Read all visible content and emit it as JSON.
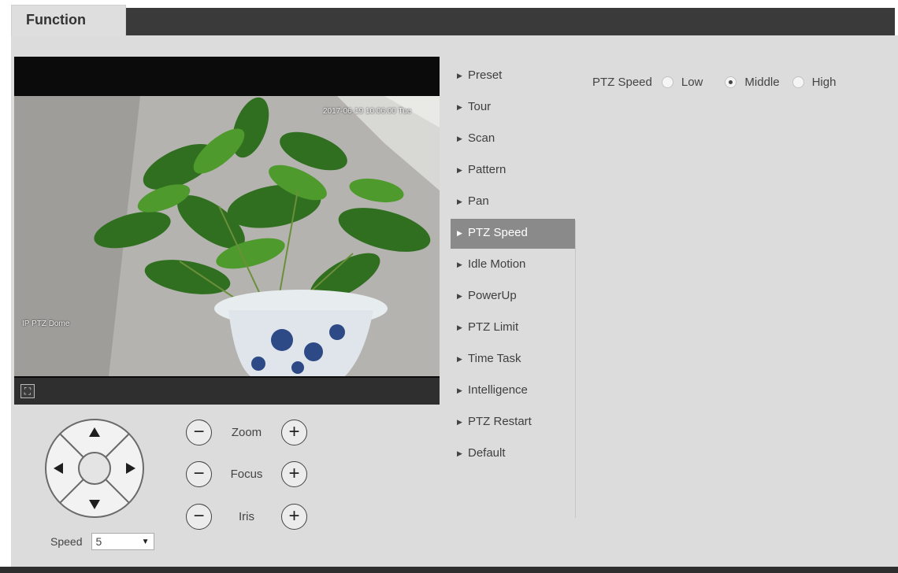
{
  "header": {
    "tab_label": "Function"
  },
  "video": {
    "timestamp": "2017-06-19 10:06:00 Tue",
    "channel_name": "IP PTZ Dome",
    "fullscreen_icon": "fullscreen-icon"
  },
  "ptz_control": {
    "speed_label": "Speed",
    "speed_value": "5",
    "zoom_label": "Zoom",
    "focus_label": "Focus",
    "iris_label": "Iris"
  },
  "menu": {
    "items": [
      {
        "label": "Preset"
      },
      {
        "label": "Tour"
      },
      {
        "label": "Scan"
      },
      {
        "label": "Pattern"
      },
      {
        "label": "Pan"
      },
      {
        "label": "PTZ Speed",
        "active": true
      },
      {
        "label": "Idle Motion"
      },
      {
        "label": "PowerUp"
      },
      {
        "label": "PTZ Limit"
      },
      {
        "label": "Time Task"
      },
      {
        "label": "Intelligence"
      },
      {
        "label": "PTZ Restart"
      },
      {
        "label": "Default"
      }
    ]
  },
  "settings": {
    "ptz_speed_label": "PTZ Speed",
    "options": [
      {
        "label": "Low",
        "checked": false
      },
      {
        "label": "Middle",
        "checked": true
      },
      {
        "label": "High",
        "checked": false
      }
    ]
  },
  "colors": {
    "panel_bg": "#dcdcdc",
    "header_bg": "#3a3a3a",
    "menu_active_bg": "#8a8a8a"
  }
}
